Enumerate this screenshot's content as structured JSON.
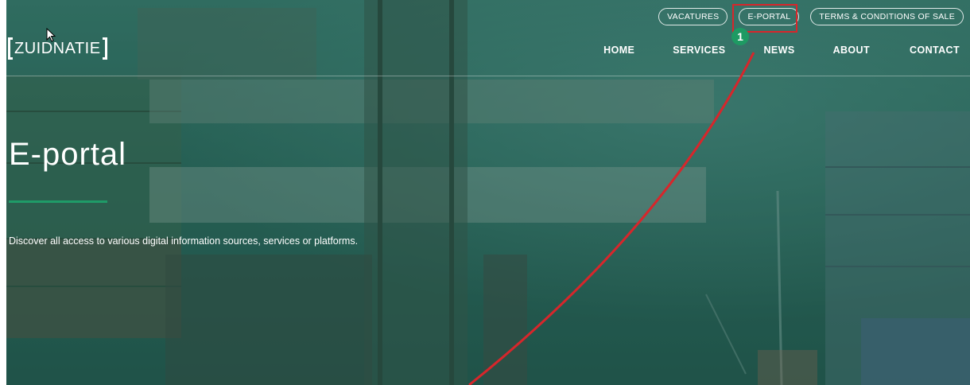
{
  "util_nav": [
    {
      "label": "VACATURES"
    },
    {
      "label": "E-PORTAL"
    },
    {
      "label": "TERMS & CONDITIONS OF SALE"
    }
  ],
  "logo": {
    "text": "ZUIDNATIE"
  },
  "main_nav": [
    {
      "label": "HOME"
    },
    {
      "label": "SERVICES"
    },
    {
      "label": "NEWS"
    },
    {
      "label": "ABOUT"
    },
    {
      "label": "CONTACT"
    }
  ],
  "hero": {
    "title": "E-portal",
    "description": "Discover all access to various digital information sources, services or platforms."
  },
  "annotation": {
    "step": "1"
  },
  "colors": {
    "accent": "#1f9b68",
    "highlight": "#d7262b",
    "overlay": "#2c6a5e"
  }
}
